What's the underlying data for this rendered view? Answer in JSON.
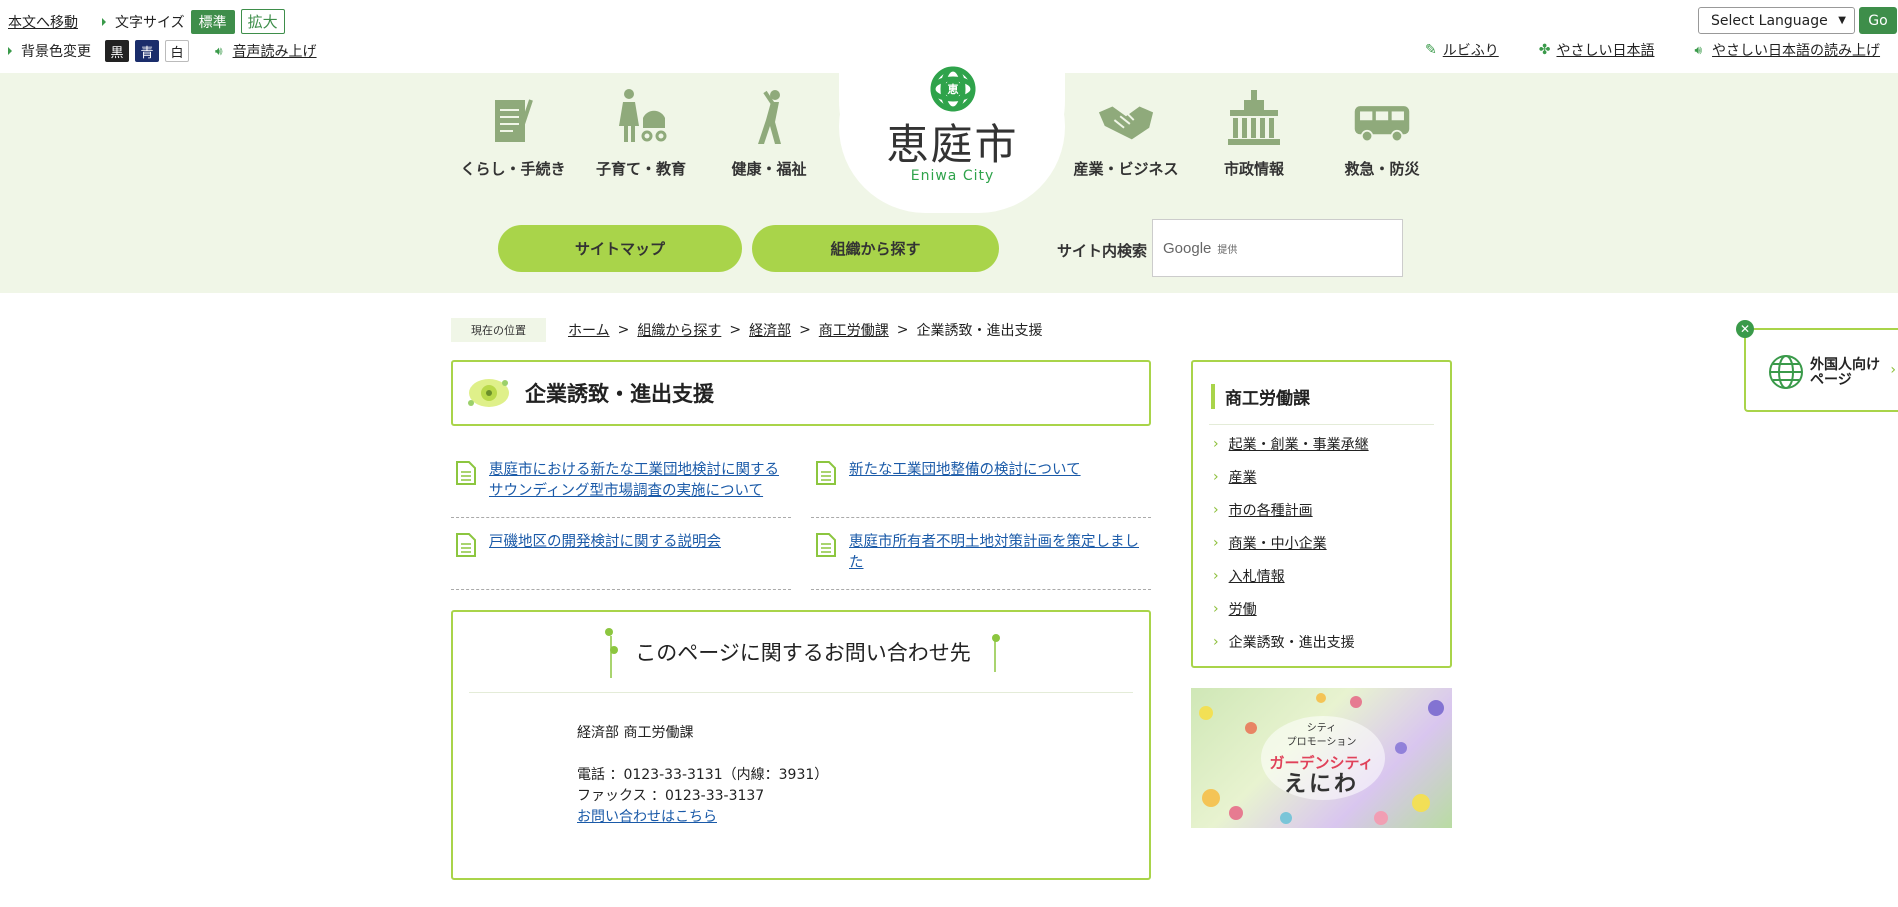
{
  "utility": {
    "skip_link": "本文へ移動",
    "font_size_label": "文字サイズ",
    "font_standard": "標準",
    "font_large": "拡大",
    "bg_color_label": "背景色変更",
    "bg_black": "黒",
    "bg_blue": "青",
    "bg_white": "白",
    "read_aloud": "音声読み上げ",
    "ruby": "ルビふり",
    "easy_japanese": "やさしい日本語",
    "easy_japanese_read": "やさしい日本語の読み上げ",
    "language_select": "Select Language",
    "go": "Go"
  },
  "header": {
    "logo_kanji": "恵庭市",
    "logo_roman": "Eniwa City",
    "logo_mark": "恵",
    "nav_left": [
      {
        "label": "くらし・手続き",
        "icon": "document-pen-icon"
      },
      {
        "label": "子育て・教育",
        "icon": "stroller-icon"
      },
      {
        "label": "健康・福祉",
        "icon": "stretching-person-icon"
      }
    ],
    "nav_right": [
      {
        "label": "産業・ビジネス",
        "icon": "handshake-icon"
      },
      {
        "label": "市政情報",
        "icon": "city-hall-icon"
      },
      {
        "label": "救急・防災",
        "icon": "ambulance-icon"
      }
    ],
    "sitemap": "サイトマップ",
    "by_org": "組織から探す",
    "search_label": "サイト内検索",
    "search_google": "Google",
    "search_provided": "提供"
  },
  "breadcrumb": {
    "here": "現在の位置",
    "items": [
      "ホーム",
      "組織から探す",
      "経済部",
      "商工労働課"
    ],
    "current": "企業誘致・進出支援",
    "separator": ">"
  },
  "main": {
    "title": "企業誘致・進出支援",
    "links": [
      [
        "恵庭市における新たな工業団地検討に関する",
        "サウンディング型市場調査の実施について"
      ],
      [
        "新たな工業団地整備の検討について"
      ],
      [
        "戸磯地区の開発検討に関する説明会"
      ],
      [
        "恵庭市所有者不明土地対策計画を策定しまし",
        "た"
      ]
    ],
    "contact": {
      "title": "このページに関するお問い合わせ先",
      "dept": "経済部 商工労働課",
      "tel": "電話 ：0123-33-3131（内線：3931）",
      "fax": "ファックス ：0123-33-3137",
      "form_link": "お問い合わせはこちら"
    }
  },
  "side": {
    "heading": "商工労働課",
    "items": [
      "起業・創業・事業承継",
      "産業",
      "市の各種計画",
      "商業・中小企業",
      "入札情報",
      "労働",
      "企業誘致・進出支援"
    ],
    "promo": {
      "line1": "シティ",
      "line2": "プロモーション",
      "line3": "ガーデンシティ",
      "line4": "えにわ"
    }
  },
  "foreign_tab": {
    "line1": "外国人向け",
    "line2": "ページ"
  },
  "colors": {
    "accent_green": "#a9d44a",
    "dark_green": "#3e8e4a",
    "band_bg": "#f0f6e7",
    "link_blue": "#1a5aa8"
  }
}
